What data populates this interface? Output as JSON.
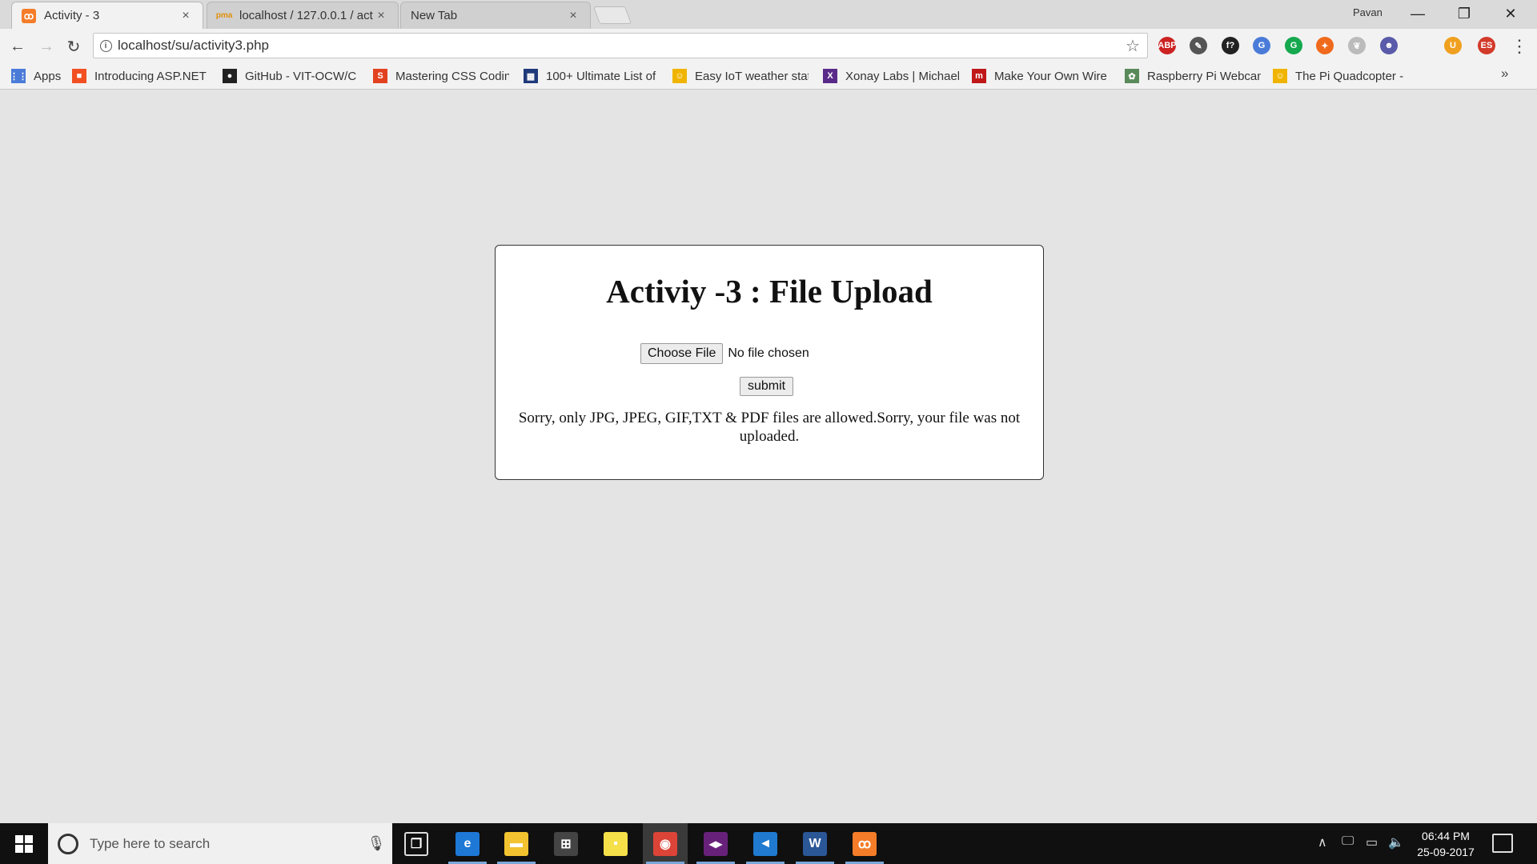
{
  "browser": {
    "tabs": [
      {
        "label": "Activity - 3",
        "close": "×",
        "active": true
      },
      {
        "label": "localhost / 127.0.0.1 / act",
        "close": "×",
        "active": false
      },
      {
        "label": "New Tab",
        "close": "×",
        "active": false
      }
    ],
    "profile_name": "Pavan",
    "window_controls": {
      "minimize": "—",
      "restore": "❐",
      "close": "✕"
    },
    "nav": {
      "back": "←",
      "forward": "→",
      "reload": "↻"
    },
    "url": "localhost/su/activity3.php",
    "info_glyph": "i",
    "star_glyph": "☆",
    "extensions": [
      {
        "name": "adblock-plus-icon",
        "text": "ABP",
        "color": "#cc2222"
      },
      {
        "name": "eyedropper-icon",
        "text": "✎",
        "color": "#555555"
      },
      {
        "name": "formula-icon",
        "text": "f?",
        "color": "#222222"
      },
      {
        "name": "google-translate-icon",
        "text": "G",
        "color": "#4a7bd8"
      },
      {
        "name": "grammarly-icon",
        "text": "G",
        "color": "#15a84e"
      },
      {
        "name": "postman-icon",
        "text": "✦",
        "color": "#f06a1d"
      },
      {
        "name": "feather-icon",
        "text": "❦",
        "color": "#bbbbbb"
      },
      {
        "name": "robot-icon",
        "text": "☻",
        "color": "#5a5aaa"
      },
      {
        "name": "orange-extension-icon",
        "text": "U",
        "color": "#f0a020"
      },
      {
        "name": "es-extension-icon",
        "text": "ES",
        "color": "#d23a2a"
      }
    ],
    "menu_glyph": "⋮"
  },
  "bookmarks": {
    "items": [
      {
        "label": "Apps",
        "icon": "apps-grid-icon",
        "color": "#4a7bd8",
        "glyph": "⋮⋮"
      },
      {
        "label": "Introducing ASP.NET",
        "icon": "microsoft-icon",
        "color": "#f25022",
        "glyph": "■"
      },
      {
        "label": "GitHub - VIT-OCW/C",
        "icon": "github-icon",
        "color": "#222222",
        "glyph": "●"
      },
      {
        "label": "Mastering CSS Codin",
        "icon": "smashing-icon",
        "color": "#e2421f",
        "glyph": "S"
      },
      {
        "label": "100+ Ultimate List of",
        "icon": "list-site-icon",
        "color": "#1f3a7a",
        "glyph": "▦"
      },
      {
        "label": "Easy IoT weather stat",
        "icon": "instructables-icon",
        "color": "#f0b400",
        "glyph": "☺"
      },
      {
        "label": "Xonay Labs | Michael",
        "icon": "xonay-icon",
        "color": "#5a2a8a",
        "glyph": "X"
      },
      {
        "label": "Make Your Own Wire",
        "icon": "wire-site-icon",
        "color": "#c01818",
        "glyph": "m"
      },
      {
        "label": "Raspberry Pi Webcam",
        "icon": "raspberry-icon",
        "color": "#5a8a5a",
        "glyph": "✿"
      },
      {
        "label": "The Pi Quadcopter - ",
        "icon": "instructables-icon",
        "color": "#f0b400",
        "glyph": "☺"
      }
    ],
    "more": "»"
  },
  "page": {
    "heading": "Activiy -3 : File Upload",
    "choose_file_label": "Choose File",
    "file_status": "No file chosen",
    "submit_label": "submit",
    "message": "Sorry, only JPG, JPEG, GIF,TXT & PDF files are allowed.Sorry, your file was not uploaded."
  },
  "taskbar": {
    "search_placeholder": "Type here to search",
    "mic_glyph": "🎙",
    "apps": [
      {
        "name": "task-view-icon",
        "glyph": "❐",
        "color": "#101010",
        "open": false
      },
      {
        "name": "edge-icon",
        "glyph": "e",
        "color": "#1e78d6",
        "open": true
      },
      {
        "name": "file-explorer-icon",
        "glyph": "▬",
        "color": "#f2c230",
        "open": true
      },
      {
        "name": "store-icon",
        "glyph": "⊞",
        "color": "#444444",
        "open": false
      },
      {
        "name": "sticky-notes-icon",
        "glyph": "▪",
        "color": "#f5e04a",
        "open": false
      },
      {
        "name": "chrome-icon",
        "glyph": "◉",
        "color": "#db4437",
        "open": true,
        "active": true
      },
      {
        "name": "visual-studio-icon",
        "glyph": "◂▸",
        "color": "#68217a",
        "open": true
      },
      {
        "name": "vscode-icon",
        "glyph": "◄",
        "color": "#1f7ad0",
        "open": true
      },
      {
        "name": "word-icon",
        "glyph": "W",
        "color": "#2b5797",
        "open": true
      },
      {
        "name": "xampp-icon",
        "glyph": "ꝏ",
        "color": "#f57c28",
        "open": true
      }
    ],
    "tray": {
      "chevron": "∧",
      "network": "🖵",
      "battery": "▭",
      "volume": "🔈"
    },
    "time": "06:44 PM",
    "date": "25-09-2017"
  },
  "colors": {
    "page_bg": "#e4e4e4",
    "card_bg": "#ffffff",
    "tab_active": "#f2f2f2",
    "taskbar_bg": "#101010"
  }
}
